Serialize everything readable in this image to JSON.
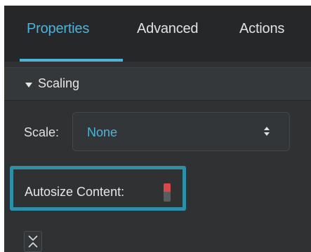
{
  "tabs": [
    {
      "label": "Properties",
      "active": true
    },
    {
      "label": "Advanced",
      "active": false
    },
    {
      "label": "Actions",
      "active": false
    }
  ],
  "section": {
    "title": "Scaling",
    "expanded": true,
    "icon": "triangle-down-icon"
  },
  "scale": {
    "label": "Scale:",
    "value": "None",
    "icon": "up-down-arrows-icon"
  },
  "autosize": {
    "label": "Autosize Content:",
    "checked": false
  },
  "collapse_button": {
    "icon": "collapse-arrows-icon"
  },
  "colors": {
    "accent": "#4fb2d9",
    "highlight": "#2d8fa8",
    "panel_bg": "#2f3133",
    "tabbar_bg": "#252729",
    "checkbox_mark": "#d84848"
  }
}
